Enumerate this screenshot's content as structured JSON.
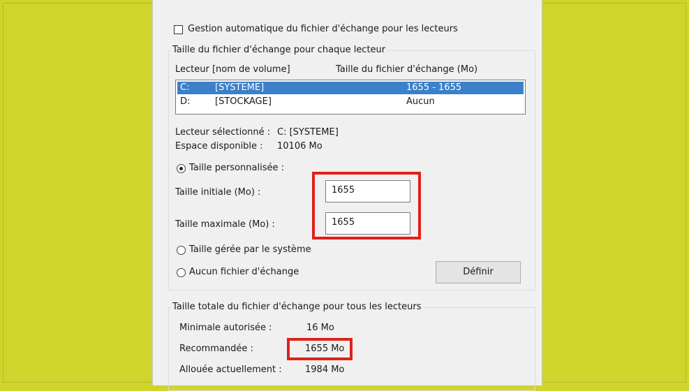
{
  "auto_manage": {
    "label": "Gestion automatique du fichier d'échange pour les lecteurs",
    "checked": false
  },
  "per_drive": {
    "group_title": "Taille du fichier d'échange pour chaque lecteur",
    "col_drive": "Lecteur [nom de volume]",
    "col_size": "Taille du fichier d'échange (Mo)",
    "drives": [
      {
        "letter": "C:",
        "volume": "[SYSTEME]",
        "size": "1655 - 1655",
        "selected": true
      },
      {
        "letter": "D:",
        "volume": "[STOCKAGE]",
        "size": "Aucun",
        "selected": false
      }
    ]
  },
  "selected": {
    "drive_label": "Lecteur sélectionné :",
    "drive_value": "C: [SYSTEME]",
    "space_label": "Espace disponible :",
    "space_value": "10106 Mo"
  },
  "custom_size": {
    "radio_label": "Taille personnalisée :",
    "initial_label": "Taille initiale (Mo) :",
    "initial_value": "1655",
    "max_label": "Taille maximale (Mo) :",
    "max_value": "1655"
  },
  "system_managed_label": "Taille gérée par le système",
  "no_pagefile_label": "Aucun fichier d'échange",
  "set_button_label": "Définir",
  "totals": {
    "group_title": "Taille totale du fichier d'échange pour tous les lecteurs",
    "min_label": "Minimale autorisée :",
    "min_value": "16 Mo",
    "recommended_label": "Recommandée :",
    "recommended_value": "1655 Mo",
    "allocated_label": "Allouée actuellement :",
    "allocated_value": "1984 Mo"
  },
  "colors": {
    "background": "#cfd52a",
    "highlight": "#e0211b",
    "selection": "#3b80c8"
  }
}
